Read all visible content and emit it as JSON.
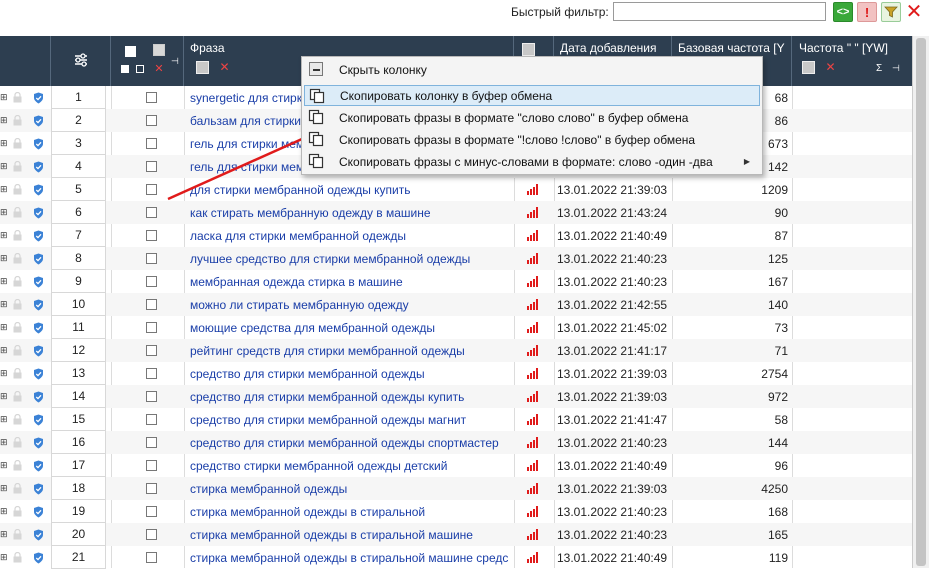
{
  "toolbar": {
    "quick_filter_label": "Быстрый фильтр:",
    "quick_filter_value": "",
    "code_button": "<>",
    "excl_button": "!",
    "close_button": "✕"
  },
  "columns": {
    "phrase": "Фраза",
    "date_added": "Дата добавления",
    "base_freq": "Базовая частота [Y",
    "freq_quoted": "Частота \" \" [YW]",
    "sigma": "Σ"
  },
  "rows": [
    {
      "num": "1",
      "phrase": "synergetic для стирки",
      "date": "",
      "freq": "68"
    },
    {
      "num": "2",
      "phrase": "бальзам для стирки",
      "date": "",
      "freq": "86"
    },
    {
      "num": "3",
      "phrase": "гель для стирки мем",
      "date": "",
      "freq": "673"
    },
    {
      "num": "4",
      "phrase": "гель для стирки мем",
      "date": "",
      "freq": "142"
    },
    {
      "num": "5",
      "phrase": "для стирки мембранной одежды купить",
      "date": "13.01.2022 21:39:03",
      "freq": "1209"
    },
    {
      "num": "6",
      "phrase": "как стирать мембранную одежду в машине",
      "date": "13.01.2022 21:43:24",
      "freq": "90"
    },
    {
      "num": "7",
      "phrase": "ласка для стирки мембранной одежды",
      "date": "13.01.2022 21:40:49",
      "freq": "87"
    },
    {
      "num": "8",
      "phrase": "лучшее средство для стирки мембранной одежды",
      "date": "13.01.2022 21:40:23",
      "freq": "125"
    },
    {
      "num": "9",
      "phrase": "мембранная одежда стирка в машине",
      "date": "13.01.2022 21:40:23",
      "freq": "167"
    },
    {
      "num": "10",
      "phrase": "можно ли стирать мембранную одежду",
      "date": "13.01.2022 21:42:55",
      "freq": "140"
    },
    {
      "num": "11",
      "phrase": "моющие средства для мембранной одежды",
      "date": "13.01.2022 21:45:02",
      "freq": "73"
    },
    {
      "num": "12",
      "phrase": "рейтинг средств для стирки мембранной одежды",
      "date": "13.01.2022 21:41:17",
      "freq": "71"
    },
    {
      "num": "13",
      "phrase": "средство для стирки мембранной одежды",
      "date": "13.01.2022 21:39:03",
      "freq": "2754"
    },
    {
      "num": "14",
      "phrase": "средство для стирки мембранной одежды купить",
      "date": "13.01.2022 21:39:03",
      "freq": "972"
    },
    {
      "num": "15",
      "phrase": "средство для стирки мембранной одежды магнит",
      "date": "13.01.2022 21:41:47",
      "freq": "58"
    },
    {
      "num": "16",
      "phrase": "средство для стирки мембранной одежды спортмастер",
      "date": "13.01.2022 21:40:23",
      "freq": "144"
    },
    {
      "num": "17",
      "phrase": "средство стирки мембранной одежды детский",
      "date": "13.01.2022 21:40:49",
      "freq": "96"
    },
    {
      "num": "18",
      "phrase": "стирка мембранной одежды",
      "date": "13.01.2022 21:39:03",
      "freq": "4250"
    },
    {
      "num": "19",
      "phrase": "стирка мембранной одежды в стиральной",
      "date": "13.01.2022 21:40:23",
      "freq": "168"
    },
    {
      "num": "20",
      "phrase": "стирка мембранной одежды в стиральной машине",
      "date": "13.01.2022 21:40:23",
      "freq": "165"
    },
    {
      "num": "21",
      "phrase": "стирка мембранной одежды в стиральной машине средс",
      "date": "13.01.2022 21:40:49",
      "freq": "119"
    }
  ],
  "context_menu": [
    {
      "label": "Скрыть колонку",
      "icon": "minus-icon"
    },
    {
      "label": "Скопировать колонку в буфер обмена",
      "icon": "copy-icon",
      "highlighted": true
    },
    {
      "label": "Скопировать фразы в формате \"слово слово\" в буфер обмена",
      "icon": "copy-icon"
    },
    {
      "label": "Скопировать фразы в формате \"!слово !слово\" в буфер обмена",
      "icon": "copy-icon"
    },
    {
      "label": "Скопировать фразы с минус-словами в формате: слово -один -два",
      "icon": "copy-icon",
      "submenu": true
    }
  ],
  "colors": {
    "header_bg": "#2d3e50",
    "phrase_text": "#1a3ea8",
    "annotation_arrow": "#e01b1b",
    "bars_icon": "#e01b1b",
    "shield_icon": "#3b82d6"
  }
}
